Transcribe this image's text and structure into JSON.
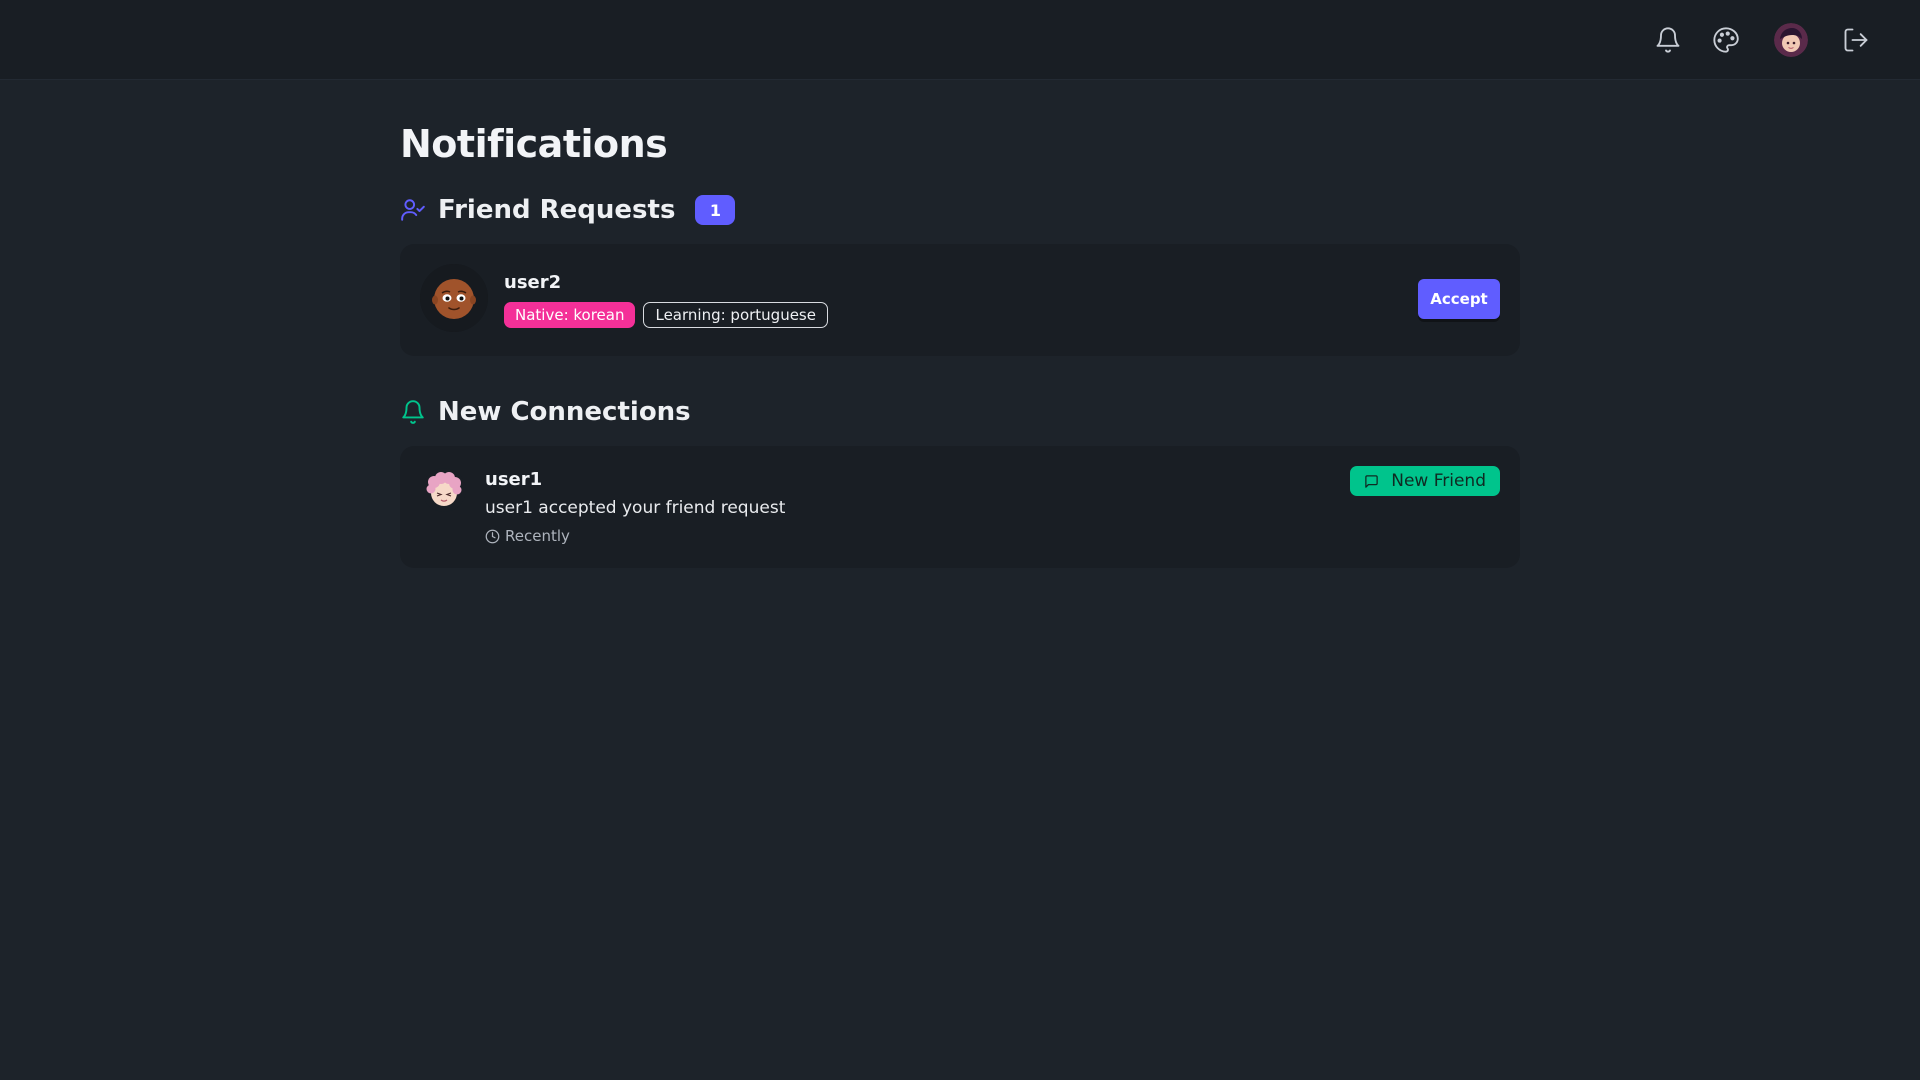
{
  "topbar": {
    "icons": [
      "bell-icon",
      "palette-icon",
      "avatar",
      "logout-icon"
    ]
  },
  "page": {
    "title": "Notifications"
  },
  "friend_requests": {
    "title": "Friend Requests",
    "count": "1",
    "icon": "user-check-icon",
    "items": [
      {
        "name": "user2",
        "native": "Native: korean",
        "learning": "Learning: portuguese",
        "accept_label": "Accept"
      }
    ]
  },
  "new_connections": {
    "title": "New Connections",
    "icon": "bell-icon",
    "items": [
      {
        "name": "user1",
        "message": "user1 accepted your friend request",
        "time": "Recently",
        "badge": "New Friend"
      }
    ]
  },
  "colors": {
    "background": "#1d232a",
    "card": "#191e24",
    "primary": "#605dff",
    "native_tag": "#f43098",
    "success": "#00c48c"
  }
}
